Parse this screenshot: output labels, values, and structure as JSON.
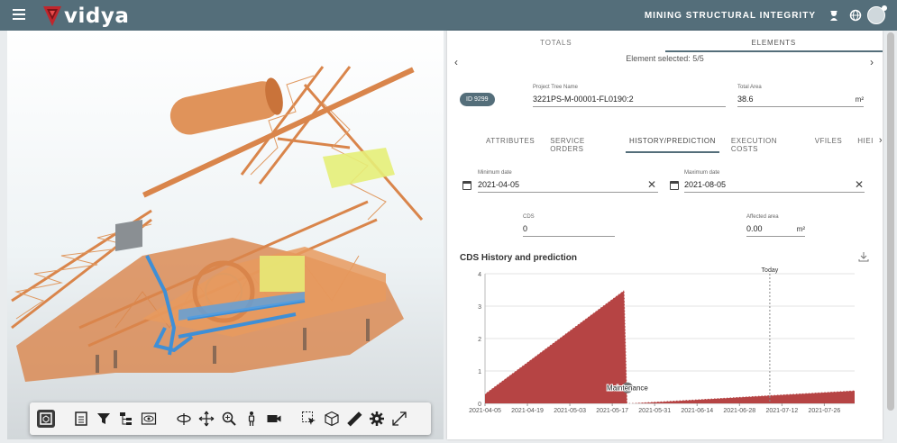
{
  "header": {
    "logo_text": "vidya",
    "app_title": "MINING STRUCTURAL INTEGRITY"
  },
  "panel": {
    "tabs": [
      "TOTALS",
      "ELEMENTS"
    ],
    "selection_text": "Element selected: 5/5",
    "id_badge": "ID 9299",
    "project_tree": {
      "label": "Project Tree Name",
      "value": "3221PS-M-00001-FL0190:2"
    },
    "total_area": {
      "label": "Total Area",
      "value": "38.6",
      "unit": "m²"
    },
    "subtabs": [
      "ATTRIBUTES",
      "SERVICE ORDERS",
      "HISTORY/PREDICTION",
      "EXECUTION COSTS",
      "VFILES",
      "HIEI"
    ],
    "min_date": {
      "label": "Minimum date",
      "value": "2021-04-05"
    },
    "max_date": {
      "label": "Maximum date",
      "value": "2021-08-05"
    },
    "cds": {
      "label": "CDS",
      "value": "0"
    },
    "affected_area": {
      "label": "Affected area",
      "value": "0.00",
      "unit": "m²"
    },
    "chart_title": "CDS History and prediction"
  },
  "toolbar": [
    "view-cube",
    "properties",
    "filter",
    "tree",
    "visibility",
    "orbit",
    "pan",
    "zoom",
    "walk",
    "camera",
    "select",
    "section",
    "measure",
    "settings",
    "fullscreen"
  ],
  "colors": {
    "topbar": "#546e7a",
    "series": "#b23a3a",
    "accent": "#546e7a"
  },
  "chart_data": {
    "type": "area",
    "title": "CDS History and prediction",
    "x_ticks": [
      "2021-04-05",
      "2021-04-19",
      "2021-05-03",
      "2021-05-17",
      "2021-05-31",
      "2021-06-14",
      "2021-06-28",
      "2021-07-12",
      "2021-07-26"
    ],
    "y_ticks": [
      0,
      1,
      2,
      3,
      4
    ],
    "ylim": [
      0,
      4
    ],
    "xlim": [
      "2021-04-05",
      "2021-08-05"
    ],
    "series": [
      {
        "points": [
          [
            "2021-04-05",
            0.3
          ],
          [
            "2021-05-21",
            3.5
          ],
          [
            "2021-05-22",
            0.0
          ],
          [
            "2021-08-05",
            0.4
          ]
        ]
      }
    ],
    "annotations": [
      {
        "text": "Maintenance",
        "x": "2021-05-22",
        "y": 0.4
      },
      {
        "text": "Today",
        "x": "2021-07-08"
      }
    ],
    "grid": true
  }
}
